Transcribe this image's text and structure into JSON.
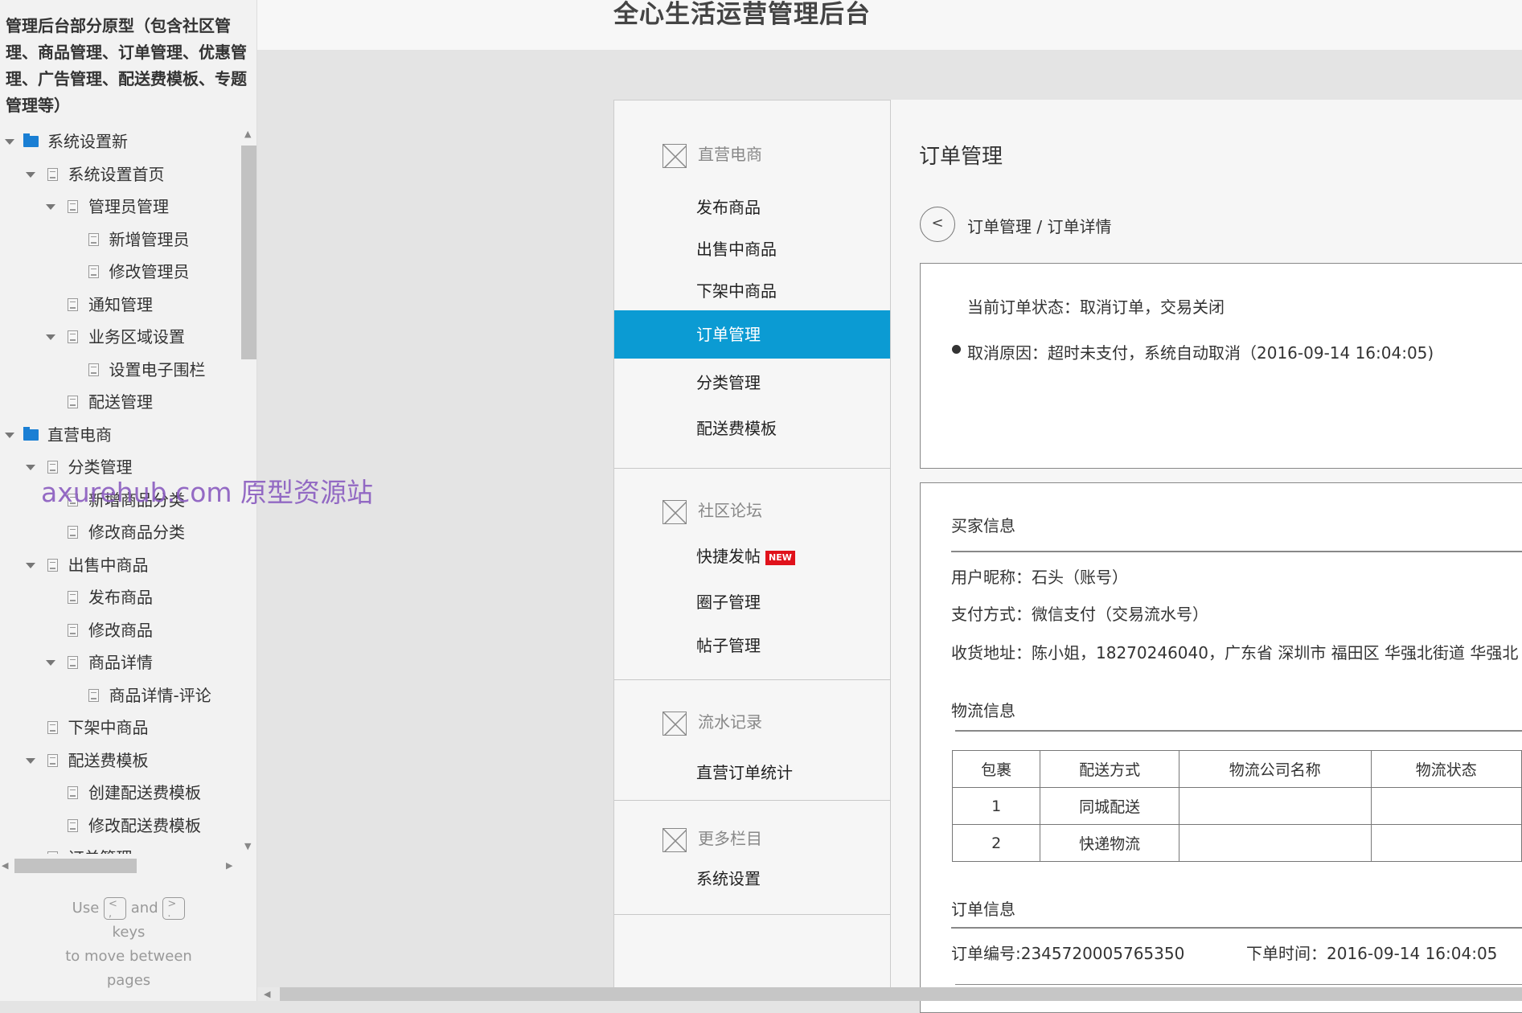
{
  "sidebar": {
    "title": "管理后台部分原型（包含社区管理、商品管理、订单管理、优惠管理、广告管理、配送费模板、专题管理等）",
    "tree": [
      {
        "label": "系统设置新",
        "level": 0,
        "type": "folder",
        "expanded": true
      },
      {
        "label": "系统设置首页",
        "level": 1,
        "type": "page",
        "expanded": true
      },
      {
        "label": "管理员管理",
        "level": 2,
        "type": "page",
        "expanded": true
      },
      {
        "label": "新增管理员",
        "level": 3,
        "type": "page"
      },
      {
        "label": "修改管理员",
        "level": 3,
        "type": "page"
      },
      {
        "label": "通知管理",
        "level": 2,
        "type": "page"
      },
      {
        "label": "业务区域设置",
        "level": 2,
        "type": "page",
        "expanded": true
      },
      {
        "label": "设置电子围栏",
        "level": 3,
        "type": "page"
      },
      {
        "label": "配送管理",
        "level": 2,
        "type": "page"
      },
      {
        "label": "直营电商",
        "level": 0,
        "type": "folder",
        "expanded": true
      },
      {
        "label": "分类管理",
        "level": 1,
        "type": "page",
        "expanded": true
      },
      {
        "label": "新增商品分类",
        "level": 2,
        "type": "page"
      },
      {
        "label": "修改商品分类",
        "level": 2,
        "type": "page"
      },
      {
        "label": "出售中商品",
        "level": 1,
        "type": "page",
        "expanded": true
      },
      {
        "label": "发布商品",
        "level": 2,
        "type": "page"
      },
      {
        "label": "修改商品",
        "level": 2,
        "type": "page"
      },
      {
        "label": "商品详情",
        "level": 2,
        "type": "page",
        "expanded": true
      },
      {
        "label": "商品详情-评论",
        "level": 3,
        "type": "page"
      },
      {
        "label": "下架中商品",
        "level": 1,
        "type": "page"
      },
      {
        "label": "配送费模板",
        "level": 1,
        "type": "page",
        "expanded": true
      },
      {
        "label": "创建配送费模板",
        "level": 2,
        "type": "page"
      },
      {
        "label": "修改配送费模板",
        "level": 2,
        "type": "page"
      },
      {
        "label": "订单管理",
        "level": 1,
        "type": "page",
        "expanded": true
      }
    ],
    "help": {
      "use": "Use",
      "key_prev": "<",
      "key_prev_sub": ",",
      "and": "and",
      "key_next": ">",
      "key_next_sub": ".",
      "keys": "keys",
      "line3": "to move between",
      "line4": "pages"
    }
  },
  "watermark": "axurehub.com 原型资源站",
  "header": {
    "title": "全心生活运营管理后台"
  },
  "nav": {
    "sections": [
      {
        "title": "直营电商",
        "items": [
          "发布商品",
          "出售中商品",
          "下架中商品",
          "订单管理",
          "分类管理",
          "配送费模板"
        ]
      },
      {
        "title": "社区论坛",
        "items": [
          "快捷发帖",
          "圈子管理",
          "帖子管理"
        ]
      },
      {
        "title": "流水记录",
        "items": [
          "直营订单统计"
        ]
      },
      {
        "title": "更多栏目",
        "items": [
          "系统设置"
        ]
      }
    ],
    "active": "订单管理",
    "new_badge": "NEW",
    "accent": "#0b9bd3"
  },
  "main": {
    "title": "订单管理",
    "back": "<",
    "breadcrumb": "订单管理  / 订单详情",
    "status": "当前订单状态：取消订单，交易关闭",
    "cancel_reason": "取消原因：超时未支付，系统自动取消（2016-09-14 16:04:05)",
    "buyer": {
      "title": "买家信息",
      "nickname": "用户昵称：石头（账号）",
      "payment": "支付方式：微信支付（交易流水号）",
      "address": "收货地址：陈小姐，18270246040，广东省 深圳市 福田区 华强北街道 华强北"
    },
    "logistics": {
      "title": "物流信息",
      "headers": [
        "包裹",
        "配送方式",
        "物流公司名称",
        "物流状态"
      ],
      "rows": [
        [
          "1",
          "同城配送",
          "",
          ""
        ],
        [
          "2",
          "快递物流",
          "",
          ""
        ]
      ]
    },
    "order": {
      "title": "订单信息",
      "number": "订单编号:2345720005765350",
      "time": "下单时间：2016-09-14 16:04:05"
    }
  }
}
